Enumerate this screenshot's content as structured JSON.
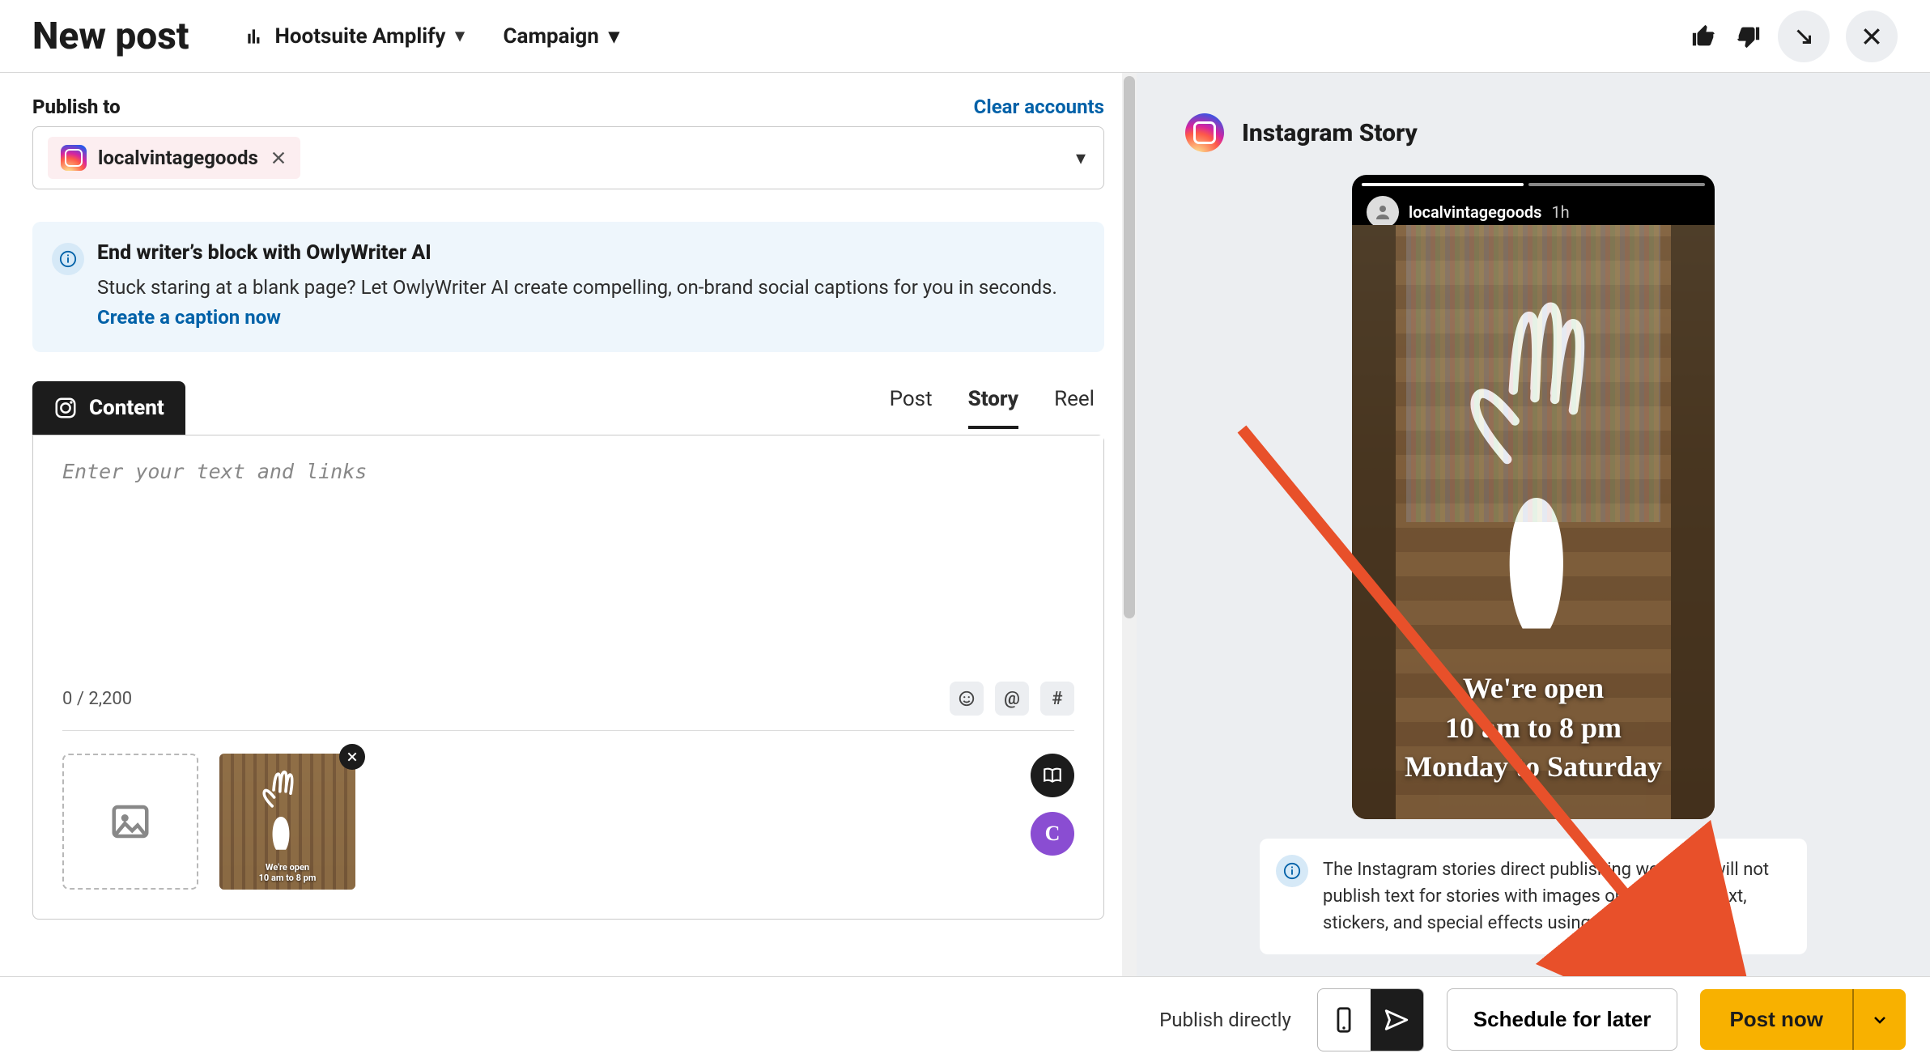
{
  "header": {
    "title": "New post",
    "amplify_label": "Hootsuite Amplify",
    "campaign_label": "Campaign"
  },
  "publish": {
    "label": "Publish to",
    "clear_label": "Clear accounts",
    "account_name": "localvintagegoods"
  },
  "ai_banner": {
    "heading": "End writer’s block with OwlyWriter AI",
    "body": "Stuck staring at a blank page? Let OwlyWriter AI create compelling, on-brand social captions for you in seconds. ",
    "cta": "Create a caption now"
  },
  "content_tab": {
    "label": "Content",
    "post_types": {
      "post": "Post",
      "story": "Story",
      "reel": "Reel"
    }
  },
  "editor": {
    "placeholder": "Enter your text and links",
    "counter": "0 / 2,200",
    "tools": {
      "emoji": "☺",
      "mention": "@",
      "hashtag": "#"
    },
    "canva_letter": "C"
  },
  "thumb": {
    "line1": "We're open",
    "line2": "10 am to 8 pm"
  },
  "preview": {
    "title": "Instagram Story",
    "username": "localvintagegoods",
    "time": "1h",
    "line1": "We're open",
    "line2": "10 am to 8 pm",
    "line3": "Monday to Saturday",
    "note": "The Instagram stories direct publishing workflow will not publish text for stories with images or video. Add text, stickers, and special effects using our Image Editor."
  },
  "footer": {
    "publish_directly": "Publish directly",
    "schedule": "Schedule for later",
    "post_now": "Post now"
  }
}
